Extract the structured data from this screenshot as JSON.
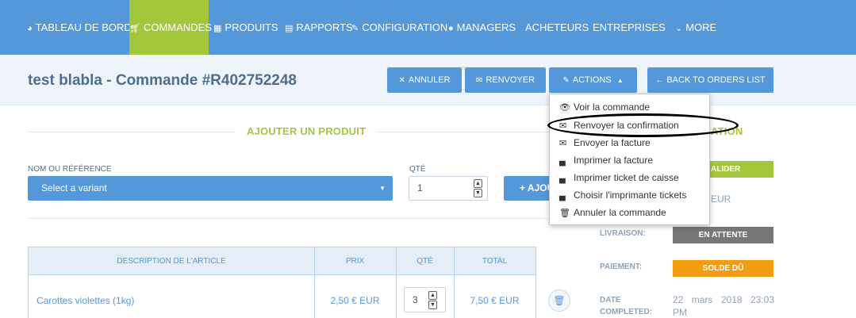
{
  "nav": {
    "items": [
      {
        "label": "TABLEAU DE BORD",
        "icon": "dashboard-icon"
      },
      {
        "label": "COMMANDES",
        "icon": "cart-icon"
      },
      {
        "label": "PRODUITS",
        "icon": "grid-icon"
      },
      {
        "label": "RAPPORTS",
        "icon": "file-icon"
      },
      {
        "label": "CONFIGURATION",
        "icon": "wrench-icon"
      },
      {
        "label": "MANAGERS",
        "icon": "user-icon"
      },
      {
        "label": "ACHETEURS"
      },
      {
        "label": "ENTREPRISES"
      },
      {
        "label": "MORE",
        "icon": "chevron-down-icon"
      }
    ],
    "active": "COMMANDES"
  },
  "header": {
    "title": "test blabla - Commande #R402752248",
    "buttons": {
      "annuler": "ANNULER",
      "renvoyer": "RENVOYER",
      "actions": "ACTIONS",
      "back": "BACK TO ORDERS LIST"
    }
  },
  "add_product": {
    "section_title": "AJOUTER UN PRODUIT",
    "name_label": "NOM OU RÉFÉRENCE",
    "variant_placeholder": "Select a variant",
    "qty_label": "QTÉ",
    "qty_value": "1",
    "add_button": "AJOUTER"
  },
  "table": {
    "headers": [
      "DESCRIPTION DE L'ARTICLE",
      "PRIX",
      "QTÉ",
      "TOTAL"
    ],
    "rows": [
      {
        "description": "Carottes violettes (1kg)",
        "price": "2,50 € EUR",
        "qty": "3",
        "total": "7,50 € EUR"
      }
    ]
  },
  "right": {
    "section_fragment": "ATION",
    "validate_fragment": "ALIDER",
    "status_fragment": "EUR",
    "livraison_label": "LIVRAISON:",
    "livraison_status": "EN ATTENTE",
    "paiement_label": "PAIEMENT:",
    "paiement_status": "SOLDE DÛ",
    "date_label_1": "DATE",
    "date_label_2": "COMPLETED:",
    "date_value": "22 mars 2018 23:03 PM"
  },
  "dropdown": {
    "items": [
      {
        "label": "Voir la commande",
        "icon": "eye-icon"
      },
      {
        "label": "Renvoyer la confirmation",
        "icon": "envelope-icon"
      },
      {
        "label": "Envoyer la facture",
        "icon": "envelope-icon"
      },
      {
        "label": "Imprimer la facture",
        "icon": "printer-icon"
      },
      {
        "label": "Imprimer ticket de caisse",
        "icon": "printer-icon"
      },
      {
        "label": "Choisir l'imprimante tickets",
        "icon": "printer-icon"
      },
      {
        "label": "Annuler la commande",
        "icon": "trash-icon"
      }
    ]
  },
  "colors": {
    "nav_bg": "#5498da",
    "active_green": "#a3c73a",
    "header_bg": "#eef4fa",
    "status_grey": "#777777",
    "status_orange": "#f39c12"
  }
}
